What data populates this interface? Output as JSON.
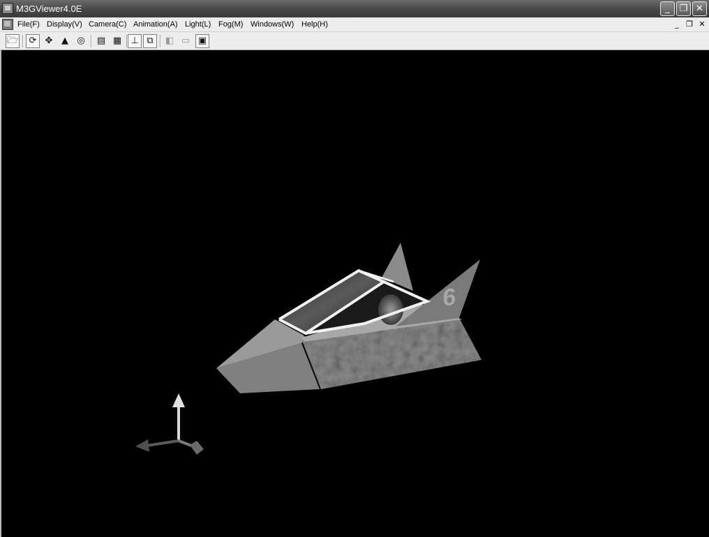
{
  "window": {
    "title": "M3GViewer4.0E",
    "minimize_glyph": "_",
    "restore_glyph": "❐",
    "close_glyph": "✕"
  },
  "menubar": {
    "items": [
      {
        "label": "File(F)"
      },
      {
        "label": "Display(V)"
      },
      {
        "label": "Camera(C)"
      },
      {
        "label": "Animation(A)"
      },
      {
        "label": "Light(L)"
      },
      {
        "label": "Fog(M)"
      },
      {
        "label": "Windows(W)"
      },
      {
        "label": "Help(H)"
      }
    ],
    "mdi_minimize_glyph": "_",
    "mdi_restore_glyph": "❐",
    "mdi_close_glyph": "✕"
  },
  "toolbar": {
    "buttons": [
      {
        "name": "open-icon",
        "glyph": "🗁"
      },
      {
        "name": "rotate-icon",
        "glyph": "⟳"
      },
      {
        "name": "move-icon",
        "glyph": "✥"
      },
      {
        "name": "tree-icon",
        "glyph": "▲"
      },
      {
        "name": "zoom-icon",
        "glyph": "◎"
      },
      {
        "name": "page-icon",
        "glyph": "▤"
      },
      {
        "name": "grid-icon",
        "glyph": "▦"
      },
      {
        "name": "axis-icon",
        "glyph": "⊥"
      },
      {
        "name": "copy-icon",
        "glyph": "⧉"
      },
      {
        "name": "light-icon",
        "glyph": "◧"
      },
      {
        "name": "fog-icon",
        "glyph": "▭"
      },
      {
        "name": "screen-icon",
        "glyph": "▣"
      }
    ]
  },
  "viewport": {
    "model_number": "6",
    "background_color": "#000000"
  }
}
